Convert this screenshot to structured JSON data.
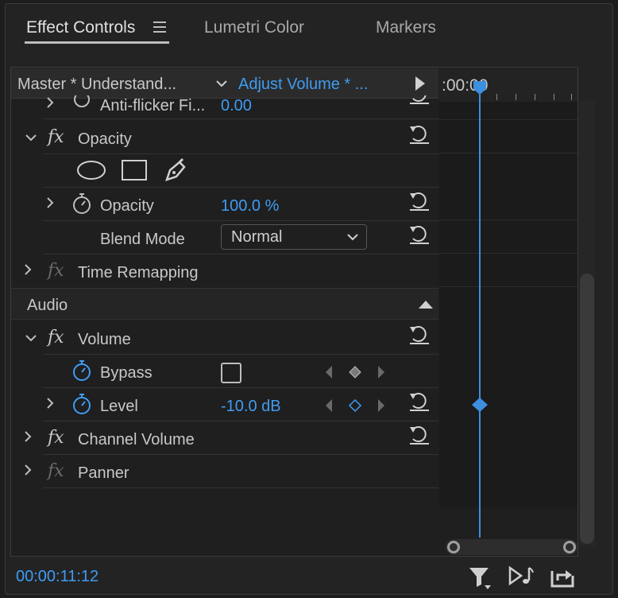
{
  "tabs": [
    {
      "label": "Effect Controls",
      "active": true
    },
    {
      "label": "Lumetri Color",
      "active": false
    },
    {
      "label": "Markers",
      "active": false
    }
  ],
  "header": {
    "master_label": "Master * Understand...",
    "clip_label": "Adjust Volume * ...",
    "timeline_time": ":00:00"
  },
  "rows": {
    "antiflicker": {
      "label": "Anti-flicker Fi...",
      "value": "0.00"
    },
    "opacity_effect": {
      "label": "Opacity"
    },
    "opacity_param": {
      "label": "Opacity",
      "value": "100.0 %"
    },
    "blend_mode": {
      "label": "Blend Mode",
      "value": "Normal"
    },
    "time_remapping": {
      "label": "Time Remapping"
    },
    "audio_section": {
      "label": "Audio"
    },
    "volume": {
      "label": "Volume"
    },
    "bypass": {
      "label": "Bypass"
    },
    "level": {
      "label": "Level",
      "value": "-10.0 dB"
    },
    "channel_volume": {
      "label": "Channel Volume"
    },
    "panner": {
      "label": "Panner"
    }
  },
  "fx_symbol": "fx",
  "footer": {
    "timecode": "00:00:11:12"
  },
  "colors": {
    "accent": "#3f9cf2",
    "keyframe": "#3d8fe0"
  },
  "icons": [
    "hamburger-menu-icon",
    "chevron-down-icon",
    "play-triangle-icon",
    "reset-icon",
    "stopwatch-icon",
    "ellipse-mask-icon",
    "rectangle-mask-icon",
    "pen-mask-icon",
    "filter-icon",
    "play-audio-icon",
    "export-icon"
  ]
}
